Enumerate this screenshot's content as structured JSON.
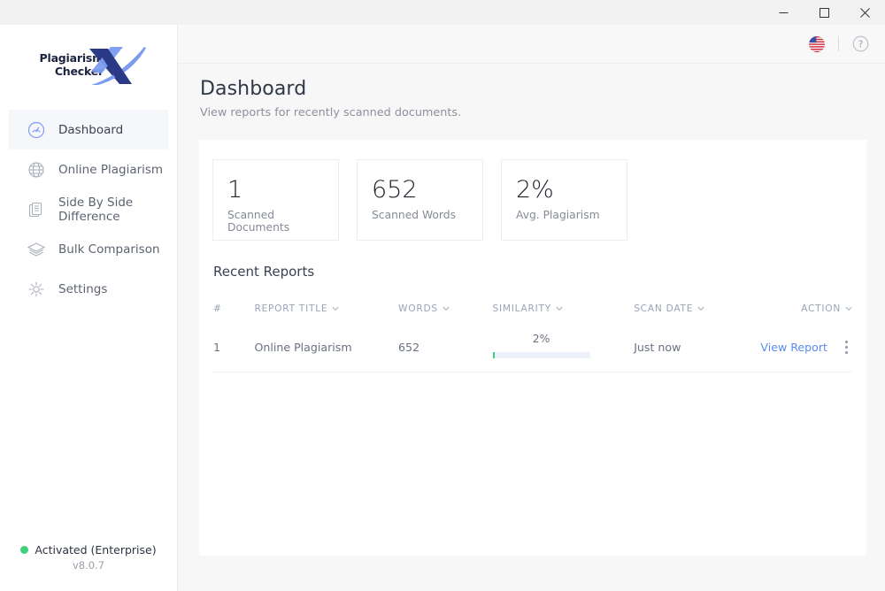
{
  "window": {
    "controls": [
      {
        "name": "minimize",
        "glyph": "minimize-icon"
      },
      {
        "name": "maximize",
        "glyph": "maximize-icon"
      },
      {
        "name": "close",
        "glyph": "close-icon"
      }
    ]
  },
  "sidebar": {
    "logo": {
      "line1": "Plagiarism",
      "line2": "Checker",
      "mark": "X"
    },
    "items": [
      {
        "label": "Dashboard",
        "icon": "gauge-icon",
        "active": true
      },
      {
        "label": "Online Plagiarism",
        "icon": "globe-icon",
        "active": false
      },
      {
        "label": "Side By Side Difference",
        "icon": "documents-icon",
        "active": false
      },
      {
        "label": "Bulk Comparison",
        "icon": "layers-icon",
        "active": false
      },
      {
        "label": "Settings",
        "icon": "gear-icon",
        "active": false
      }
    ],
    "footer": {
      "status": "Activated (Enterprise)",
      "version": "v8.0.7",
      "status_color": "#3ed17d"
    }
  },
  "topbar": {
    "language_icon": "us-flag-icon",
    "help_icon": "help-circle-icon"
  },
  "page": {
    "title": "Dashboard",
    "subtitle": "View reports for recently scanned documents."
  },
  "stats": [
    {
      "value": "1",
      "label": "Scanned Documents"
    },
    {
      "value": "652",
      "label": "Scanned Words"
    },
    {
      "value": "2%",
      "label": "Avg. Plagiarism"
    }
  ],
  "reports": {
    "section_title": "Recent Reports",
    "columns": [
      {
        "label": "#",
        "sortable": false
      },
      {
        "label": "REPORT TITLE",
        "sortable": true
      },
      {
        "label": "WORDS",
        "sortable": true
      },
      {
        "label": "SIMILARITY",
        "sortable": true
      },
      {
        "label": "SCAN DATE",
        "sortable": true
      },
      {
        "label": "ACTION",
        "sortable": true
      }
    ],
    "rows": [
      {
        "num": "1",
        "title": "Online Plagiarism",
        "words": "652",
        "similarity_label": "2%",
        "similarity_pct": 2,
        "scan_date": "Just now",
        "action_label": "View Report"
      }
    ]
  },
  "colors": {
    "accent_link": "#5b8def",
    "logo_dark": "#2a3a86",
    "logo_light": "#7c9cf0",
    "status_green": "#3ed17d",
    "bar_track": "#edf1fb"
  }
}
